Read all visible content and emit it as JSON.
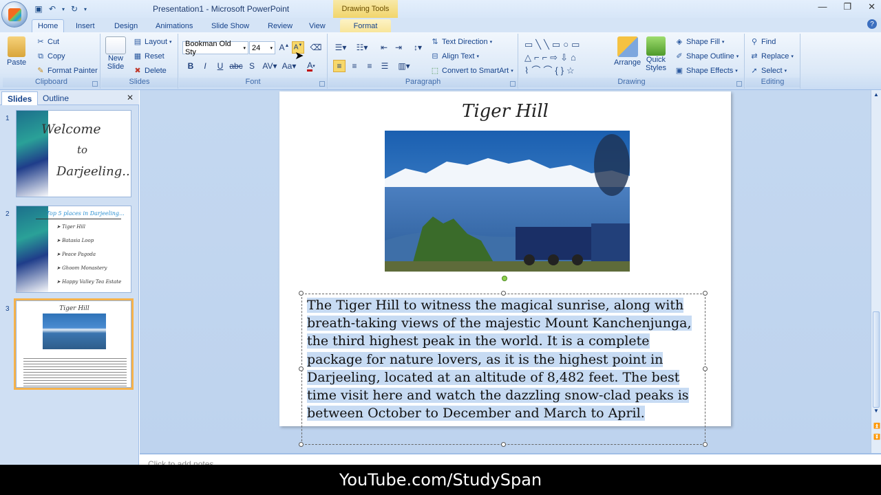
{
  "window": {
    "title": "Presentation1 - Microsoft PowerPoint",
    "contextual_tab_group": "Drawing Tools"
  },
  "tabs": [
    "Home",
    "Insert",
    "Design",
    "Animations",
    "Slide Show",
    "Review",
    "View",
    "Format"
  ],
  "active_tab": "Home",
  "ribbon": {
    "clipboard": {
      "label": "Clipboard",
      "paste": "Paste",
      "cut": "Cut",
      "copy": "Copy",
      "format_painter": "Format Painter"
    },
    "slides": {
      "label": "Slides",
      "new_slide_line1": "New",
      "new_slide_line2": "Slide",
      "layout": "Layout",
      "reset": "Reset",
      "delete": "Delete"
    },
    "font": {
      "label": "Font",
      "font_name": "Bookman Old Sty",
      "font_size": "24"
    },
    "paragraph": {
      "label": "Paragraph",
      "text_direction": "Text Direction",
      "align_text": "Align Text",
      "convert_smartart": "Convert to SmartArt"
    },
    "drawing": {
      "label": "Drawing",
      "arrange": "Arrange",
      "quick_styles_line1": "Quick",
      "quick_styles_line2": "Styles",
      "shape_fill": "Shape Fill",
      "shape_outline": "Shape Outline",
      "shape_effects": "Shape Effects"
    },
    "editing": {
      "label": "Editing",
      "find": "Find",
      "replace": "Replace",
      "select": "Select"
    }
  },
  "pane": {
    "tabs": [
      "Slides",
      "Outline"
    ],
    "thumbnails": [
      {
        "number": "1",
        "lines": [
          "Welcome",
          "to",
          "Darjeeling..."
        ]
      },
      {
        "number": "2",
        "title": "Top 5 places in Darjeeling...",
        "bullets": [
          "Tiger Hill",
          "Batasia Loop",
          "Peace Pagoda",
          "Ghoom Monastery",
          "Happy Valley Tea Estate"
        ]
      },
      {
        "number": "3",
        "title": "Tiger Hill"
      }
    ]
  },
  "slide": {
    "title": "Tiger Hill",
    "body": "The Tiger Hill to witness the magical sunrise, along with breath-taking views of the majestic Mount Kanchenjunga, the third highest peak in the world. It is a complete package for nature lovers, as it is the highest point in Darjeeling, located at an altitude of 8,482 feet. The best time visit here and watch the dazzling snow-clad peaks is between October to December and March to April."
  },
  "notes_placeholder": "Click to add notes",
  "watermark": "YouTube.com/StudySpan",
  "colors": {
    "ribbon": "#dbe8f7",
    "accent_selection": "#f6b24b",
    "selection_highlight": "#c7dbf3"
  }
}
